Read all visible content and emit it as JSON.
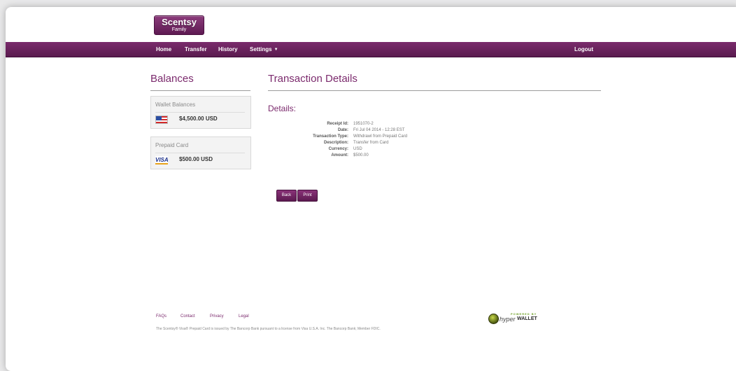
{
  "header": {
    "logo_brand": "Scentsy",
    "logo_sub": "Family"
  },
  "nav": {
    "home": "Home",
    "transfer": "Transfer",
    "history": "History",
    "settings": "Settings",
    "logout": "Logout"
  },
  "sidebar": {
    "title": "Balances",
    "wallet": {
      "title": "Wallet Balances",
      "icon": "us-flag-icon",
      "value": "$4,500.00 USD"
    },
    "prepaid": {
      "title": "Prepaid Card",
      "icon": "visa-card-icon",
      "icon_text": "VISA",
      "value": "$500.00 USD"
    }
  },
  "main": {
    "title": "Transaction Details",
    "details_heading": "Details:",
    "details": [
      {
        "label": "Receipt Id:",
        "value": "1951070-2"
      },
      {
        "label": "Date:",
        "value": "Fri Jul 04 2014 - 12:28 EST"
      },
      {
        "label": "Transaction Type:",
        "value": "Withdrawl from Prepaid Card"
      },
      {
        "label": "Description:",
        "value": "Transfer from Card"
      },
      {
        "label": "Currency:",
        "value": "USD"
      },
      {
        "label": "Amount:",
        "value": "$500.00"
      }
    ],
    "back_label": "Back",
    "print_label": "Print"
  },
  "footer": {
    "links": [
      "FAQs",
      "Contact",
      "Privacy",
      "Legal"
    ],
    "disclaimer": "The Scentsy® Visa® Prepaid Card is issued by The Bancorp Bank pursuant to a license from Visa U.S.A. Inc. The Bancorp Bank; Member FDIC.",
    "powered_by": "POWERED BY",
    "hyper": "hyper",
    "wallet": "WALLET"
  },
  "colors": {
    "brand": "#6b2160",
    "accent_text": "#7b2a6d"
  }
}
